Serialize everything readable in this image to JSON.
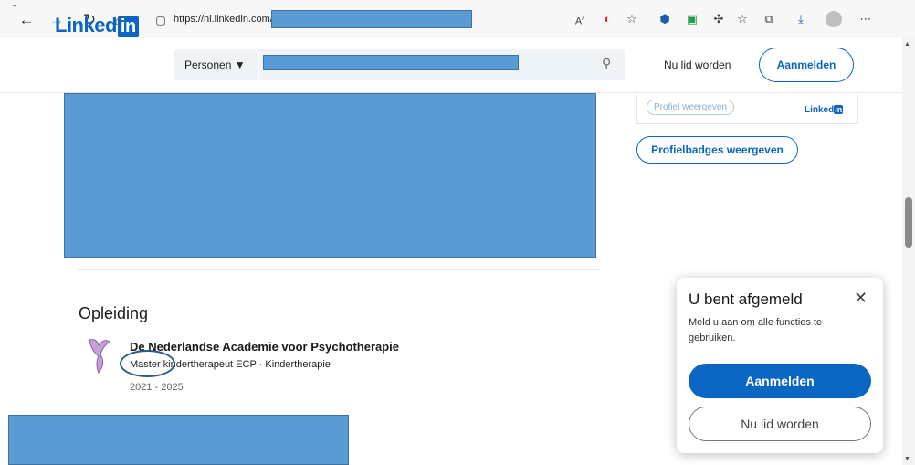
{
  "browser": {
    "url": "https://nl.linkedin.com/in/",
    "icons": [
      "back-icon",
      "forward-icon",
      "refresh-icon",
      "home-icon",
      "lock-icon",
      "read-aloud-icon",
      "tracking-icon",
      "favorite-icon",
      "extension-icon",
      "extension-icon",
      "extensions-icon",
      "favorites-icon",
      "collections-icon",
      "downloads-icon",
      "profile-icon",
      "more-icon"
    ]
  },
  "header": {
    "logo_text": "Linked",
    "logo_in": "in",
    "search_scope": "Personen ▼",
    "join_label": "Nu lid worden",
    "signin_label": "Aanmelden"
  },
  "sidebar": {
    "profile_view_label": "Profiel weergeven",
    "mini_logo_text": "Linked",
    "mini_logo_in": "in",
    "badges_button": "Profielbadges weergeven"
  },
  "education": {
    "section_title": "Opleiding",
    "school": "De Nederlandse Academie voor Psychotherapie",
    "degree": "Master kindertherapeut ECP · Kindertherapie",
    "years": "2021 - 2025"
  },
  "popup": {
    "title": "U bent afgemeld",
    "description": "Meld u aan om alle functies te gebruiken.",
    "signin_label": "Aanmelden",
    "join_label": "Nu lid worden"
  },
  "colors": {
    "brand": "#0a66c2",
    "redaction": "#5b9bd5"
  }
}
